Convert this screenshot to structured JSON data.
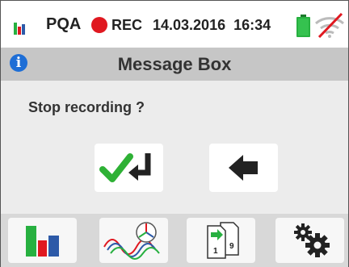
{
  "status_bar": {
    "app_name": "PQA",
    "recording_label": "REC",
    "date": "14.03.2016",
    "time": "16:34",
    "battery_icon": "battery-full-icon",
    "wifi_icon": "wifi-off-icon",
    "colors": {
      "recording": "#e01820",
      "battery": "#27b040",
      "wifi_strike": "#e01820"
    }
  },
  "title_bar": {
    "info_icon_glyph": "i",
    "title": "Message Box"
  },
  "message": {
    "text": "Stop recording ?"
  },
  "buttons": {
    "confirm_icon": "confirm-enter-icon",
    "back_icon": "back-arrow-icon"
  },
  "toolbar": {
    "items": [
      {
        "icon": "bar-chart-icon"
      },
      {
        "icon": "waveform-vector-icon"
      },
      {
        "icon": "page-copy-icon",
        "page_numbers": [
          "1",
          "9"
        ]
      },
      {
        "icon": "gears-settings-icon"
      }
    ]
  }
}
